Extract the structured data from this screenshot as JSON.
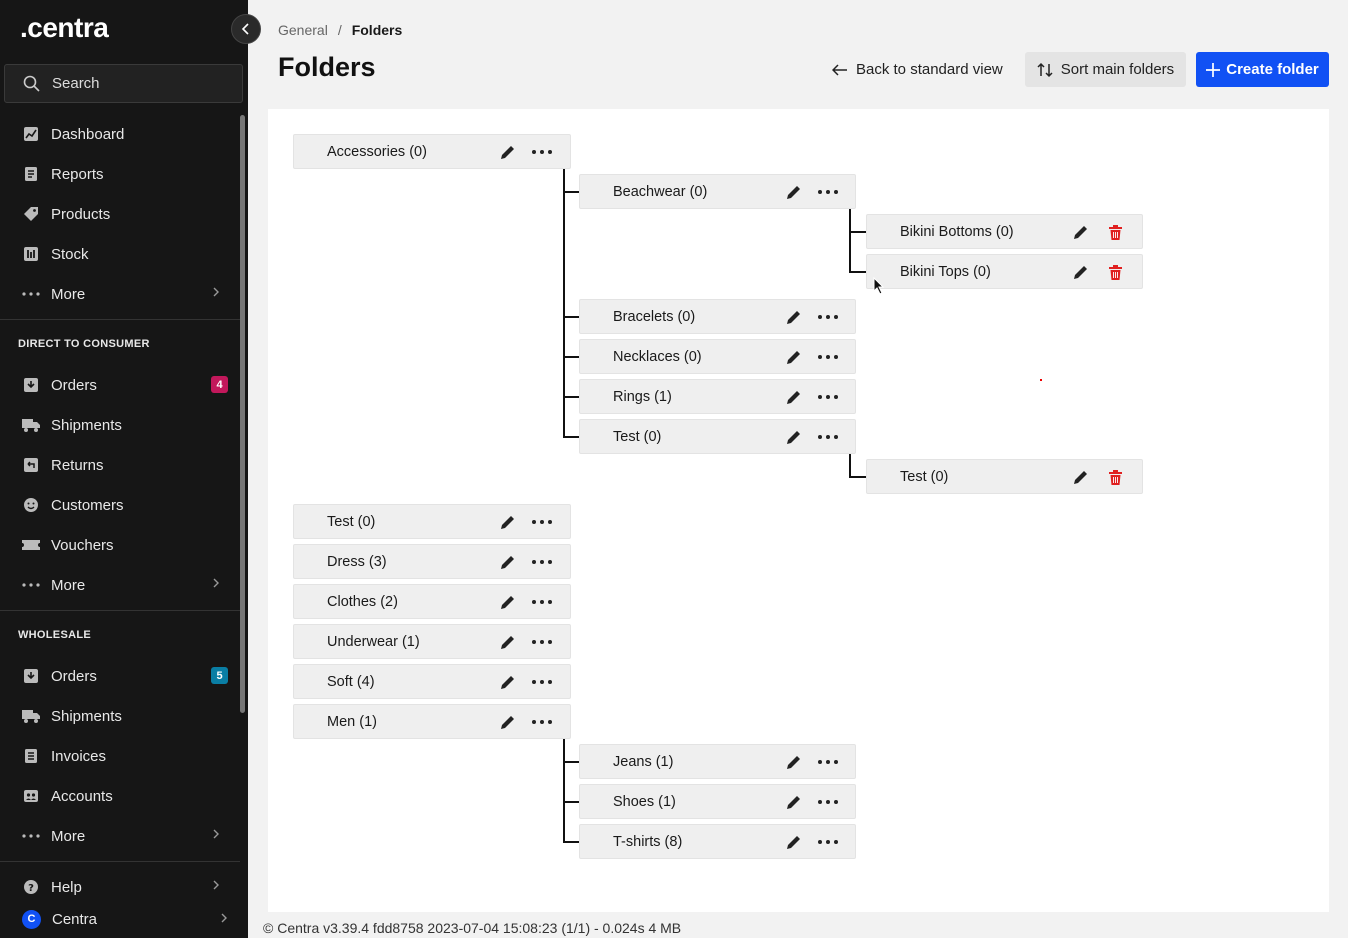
{
  "sidebar": {
    "logo": ".centra",
    "search_label": "Search",
    "main_items": [
      {
        "label": "Dashboard",
        "icon": "chart-icon"
      },
      {
        "label": "Reports",
        "icon": "report-icon"
      },
      {
        "label": "Products",
        "icon": "tag-icon"
      },
      {
        "label": "Stock",
        "icon": "stock-icon"
      },
      {
        "label": "More",
        "icon": "dots-icon"
      }
    ],
    "dtc": {
      "title": "DIRECT TO CONSUMER",
      "items": [
        {
          "label": "Orders",
          "badge": "4"
        },
        {
          "label": "Shipments"
        },
        {
          "label": "Returns"
        },
        {
          "label": "Customers"
        },
        {
          "label": "Vouchers"
        },
        {
          "label": "More"
        }
      ]
    },
    "wholesale": {
      "title": "WHOLESALE",
      "items": [
        {
          "label": "Orders",
          "badge": "5"
        },
        {
          "label": "Shipments"
        },
        {
          "label": "Invoices"
        },
        {
          "label": "Accounts"
        },
        {
          "label": "More"
        }
      ]
    },
    "help_label": "Help",
    "account_label": "Centra",
    "account_initial": "C"
  },
  "breadcrumb": {
    "parent": "General",
    "separator": "/",
    "current": "Folders"
  },
  "page_title": "Folders",
  "actions": {
    "back": "Back to standard view",
    "sort": "Sort main folders",
    "create": "Create folder"
  },
  "folders": {
    "accessories": "Accessories (0)",
    "beachwear": "Beachwear (0)",
    "bikini_bottoms": "Bikini Bottoms (0)",
    "bikini_tops": "Bikini Tops (0)",
    "bracelets": "Bracelets (0)",
    "necklaces": "Necklaces (0)",
    "rings": "Rings (1)",
    "test_sub": "Test (0)",
    "test_subsub": "Test (0)",
    "test_main": "Test (0)",
    "dress": "Dress (3)",
    "clothes": "Clothes (2)",
    "underwear": "Underwear (1)",
    "soft": "Soft (4)",
    "men": "Men (1)",
    "jeans": "Jeans (1)",
    "shoes": "Shoes (1)",
    "tshirts": "T-shirts (8)"
  },
  "footer": "© Centra v3.39.4 fdd8758 2023-07-04 15:08:23 (1/1) - 0.024s 4 MB",
  "colors": {
    "accent": "#1151f4",
    "sidebar_bg": "#161616",
    "badge_dtc": "#c2185b",
    "badge_wholesale": "#0a7ea4",
    "delete": "#e02020"
  }
}
